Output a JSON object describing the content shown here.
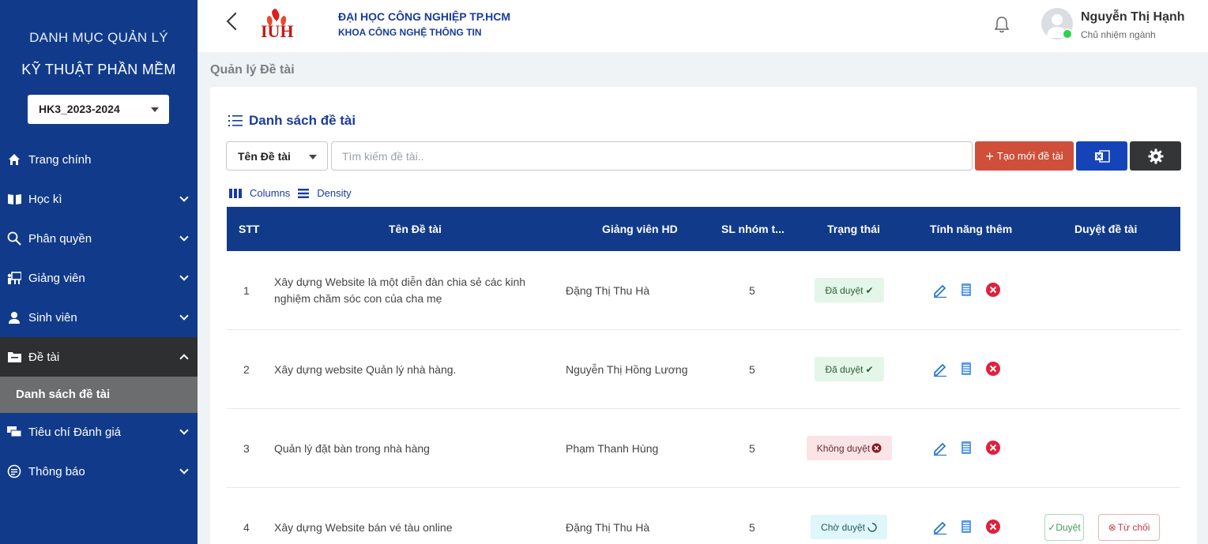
{
  "sidebar": {
    "title_line1": "DANH MỤC QUẢN LÝ",
    "title_line2": "KỸ THUẬT PHẦN MỀM",
    "semester": "HK3_2023-2024",
    "items": [
      {
        "label": "Trang chính",
        "icon": "home-icon"
      },
      {
        "label": "Học kì",
        "icon": "book-icon"
      },
      {
        "label": "Phân quyền",
        "icon": "key-search-icon"
      },
      {
        "label": "Giảng viên",
        "icon": "teacher-icon"
      },
      {
        "label": "Sinh viên",
        "icon": "student-icon"
      },
      {
        "label": "Đề tài",
        "icon": "folder-icon"
      },
      {
        "label": "Tiêu chí Đánh giá",
        "icon": "chat-icon"
      },
      {
        "label": "Thông báo",
        "icon": "message-icon"
      }
    ],
    "active_sub": "Danh sách đề tài"
  },
  "header": {
    "university": "ĐẠI HỌC CÔNG NGHIỆP TP.HCM",
    "faculty": "KHOA CÔNG NGHỆ THÔNG TIN",
    "logo_text": "IUH",
    "user_name": "Nguyễn Thị Hạnh",
    "user_role": "Chủ nhiệm ngành"
  },
  "breadcrumb": "Quản lý Đề tài",
  "main": {
    "list_title": "Danh sách đề tài",
    "filter_value": "Tên Đề tài",
    "search_placeholder": "Tìm kiếm đề tài..",
    "create_label": "Tạo mới đề tài",
    "columns_label": "Columns",
    "density_label": "Density"
  },
  "colors": {
    "sidebar_bg": "#113b8a",
    "brand_text": "#1a3c9c",
    "create_btn": "#cf4f3a",
    "excel_btn": "#1544b8",
    "settings_btn": "#333537"
  },
  "table": {
    "headers": [
      "STT",
      "Tên Đề tài",
      "Giảng viên HD",
      "SL nhóm t...",
      "Trạng thái",
      "Tính năng thêm",
      "Duyệt đề tài"
    ],
    "rows": [
      {
        "stt": "1",
        "name": "Xây dựng Website là một diễn đàn chia sẻ các kinh nghiệm chăm sóc con của cha mẹ",
        "lecturer": "Đặng Thị Thu Hà",
        "groups": "5",
        "status": "Đã duyệt",
        "status_type": "ok"
      },
      {
        "stt": "2",
        "name": "Xây dựng website Quản lý nhà hàng.",
        "lecturer": "Nguyễn Thị Hồng Lương",
        "groups": "5",
        "status": "Đã duyệt",
        "status_type": "ok"
      },
      {
        "stt": "3",
        "name": "Quản lý đặt bàn trong nhà hàng",
        "lecturer": "Phạm Thanh Hùng",
        "groups": "5",
        "status": "Không duyệt",
        "status_type": "no"
      },
      {
        "stt": "4",
        "name": "Xây dựng Website bán vé tàu online",
        "lecturer": "Đặng Thị Thu Hà",
        "groups": "5",
        "status": "Chờ duyệt",
        "status_type": "wait",
        "approve_label": "Duyệt",
        "reject_label": "Từ chối"
      }
    ]
  }
}
